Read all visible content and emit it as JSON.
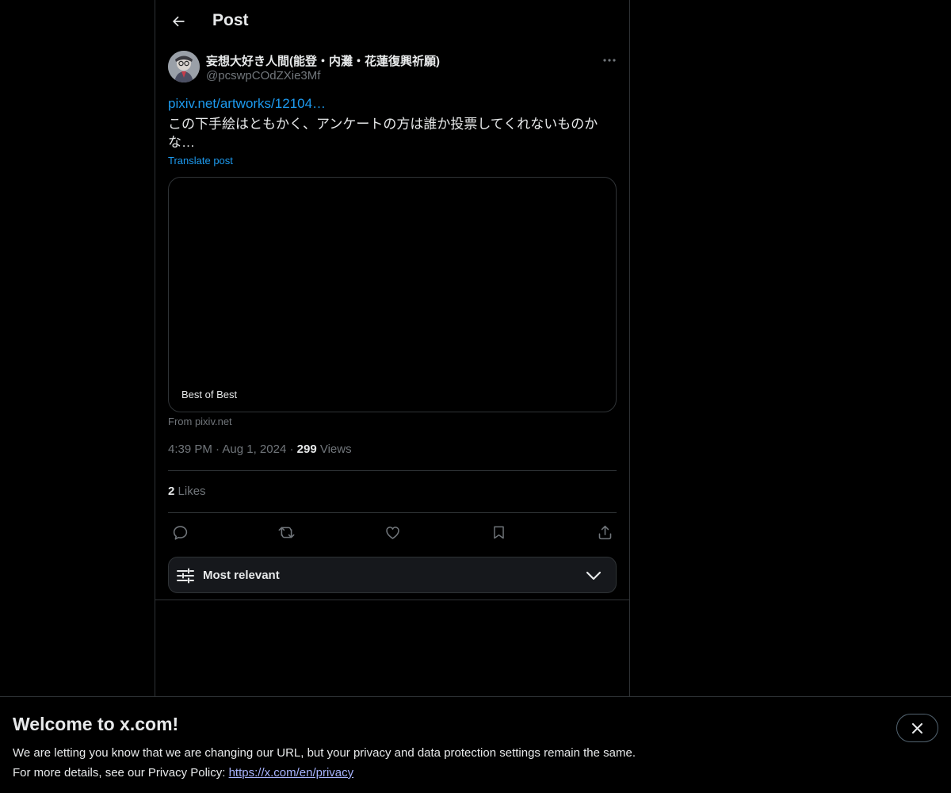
{
  "header": {
    "title": "Post"
  },
  "post": {
    "author_name": "妄想大好き人間(能登・内灘・花蓮復興祈願)",
    "author_handle": "@pcswpCOdZXie3Mf",
    "link_text": "pixiv.net/artworks/12104…",
    "text": "この下手絵はともかく、アンケートの方は誰か投票してくれないものかな…",
    "translate_label": "Translate post",
    "card_label": "Best of Best",
    "card_source": "From pixiv.net",
    "time": "4:39 PM",
    "date": "Aug 1, 2024",
    "views_count": "299",
    "views_label": "Views",
    "likes_count": "2",
    "likes_label": "Likes"
  },
  "actions": {
    "icons": [
      "reply-icon",
      "repost-icon",
      "like-icon",
      "bookmark-icon",
      "share-icon"
    ]
  },
  "sort": {
    "label": "Most relevant"
  },
  "banner": {
    "title": "Welcome to x.com!",
    "line1": "We are letting you know that we are changing our URL, but your privacy and data protection settings remain the same.",
    "line2_prefix": "For more details, see our Privacy Policy: ",
    "line2_link": "https://x.com/en/privacy"
  },
  "colors": {
    "background": "#000000",
    "text_primary": "#e7e9ea",
    "text_secondary": "#71767b",
    "accent": "#1d9bf0",
    "border": "#2f3336"
  }
}
